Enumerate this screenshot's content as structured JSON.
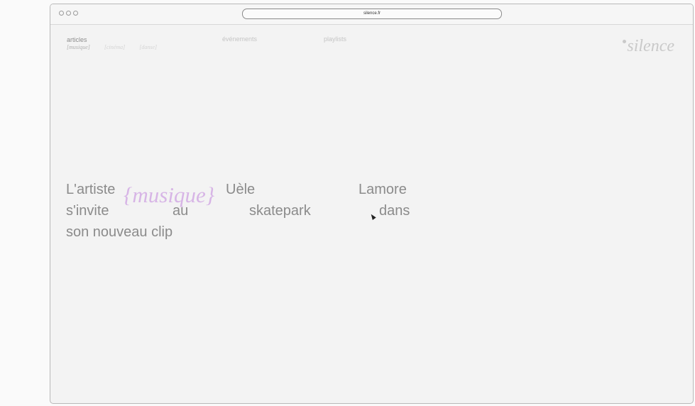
{
  "browser": {
    "url": "silence.fr"
  },
  "nav": {
    "articles": "articles",
    "events": "événements",
    "playlists": "playlists",
    "subcategories": [
      "[musique]",
      "[cinéma]",
      "[danse]"
    ]
  },
  "logo": "silence",
  "headline": {
    "words": [
      "L'artiste",
      "Uèle",
      "Lamore",
      "s'invite",
      "au",
      "skatepark",
      "dans",
      "son nouveau clip"
    ],
    "category_overlay": "{musique}"
  },
  "colors": {
    "accent": "#d7b5e6",
    "text": "#8b8b8b",
    "background": "#f3f3f3"
  }
}
